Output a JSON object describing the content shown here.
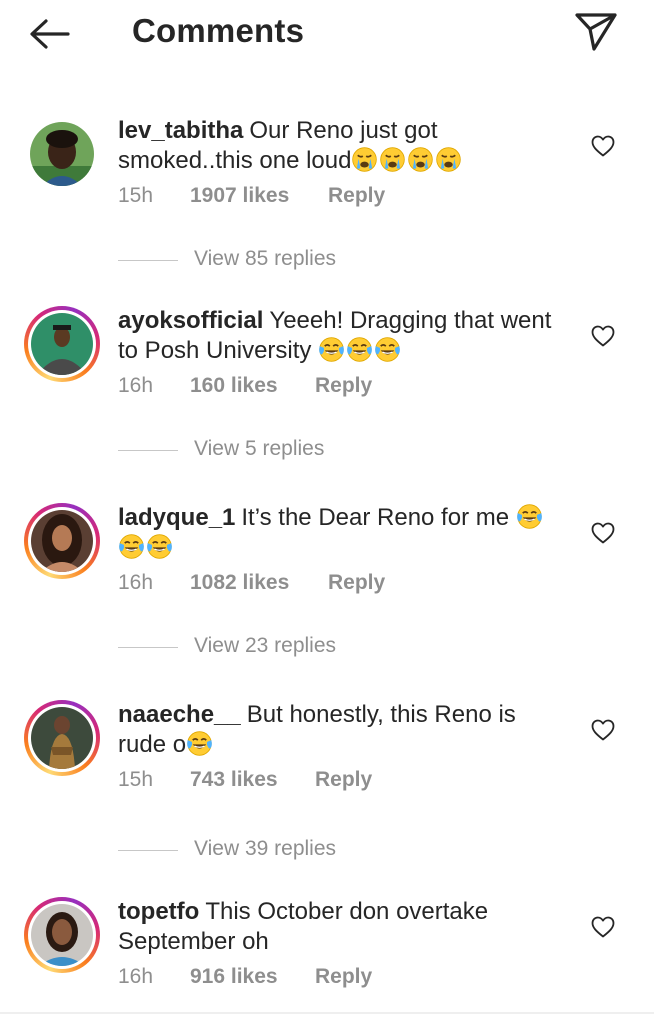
{
  "header": {
    "title": "Comments",
    "back_icon": "arrow-left-icon",
    "share_icon": "paper-plane-icon"
  },
  "colors": {
    "text": "#262626",
    "secondary": "#8e8e8e",
    "story_ring": [
      "#feda75",
      "#fa7e1e",
      "#d62976",
      "#962fbf"
    ]
  },
  "comments": [
    {
      "username": "lev_tabitha",
      "text": "Our Reno just got smoked..this one loud",
      "emojis": [
        "crying-face-emoji",
        "crying-face-emoji",
        "crying-face-emoji",
        "crying-face-emoji"
      ],
      "time": "15h",
      "likes": "1907 likes",
      "reply": "Reply",
      "view_replies": "View 85 replies",
      "has_story_ring": false
    },
    {
      "username": "ayoksofficial",
      "text": "Yeeeh! Dragging that went to Posh University",
      "emojis": [
        "tears-of-joy-emoji",
        "tears-of-joy-emoji",
        "tears-of-joy-emoji"
      ],
      "time": "16h",
      "likes": "160 likes",
      "reply": "Reply",
      "view_replies": "View 5 replies",
      "has_story_ring": true
    },
    {
      "username": "ladyque_1",
      "text": "It’s the Dear Reno for me",
      "emojis": [
        "tears-of-joy-emoji",
        "tears-of-joy-emoji",
        "tears-of-joy-emoji"
      ],
      "time": "16h",
      "likes": "1082 likes",
      "reply": "Reply",
      "view_replies": "View 23 replies",
      "has_story_ring": true
    },
    {
      "username": "naaeche__",
      "text": "But honestly, this Reno is rude o",
      "emojis": [
        "tears-of-joy-emoji"
      ],
      "time": "15h",
      "likes": "743 likes",
      "reply": "Reply",
      "view_replies": "View 39 replies",
      "has_story_ring": true
    },
    {
      "username": "topetfo",
      "text": "This October don overtake September oh",
      "emojis": [],
      "time": "16h",
      "likes": "916 likes",
      "reply": "Reply",
      "view_replies": "",
      "has_story_ring": true
    }
  ]
}
